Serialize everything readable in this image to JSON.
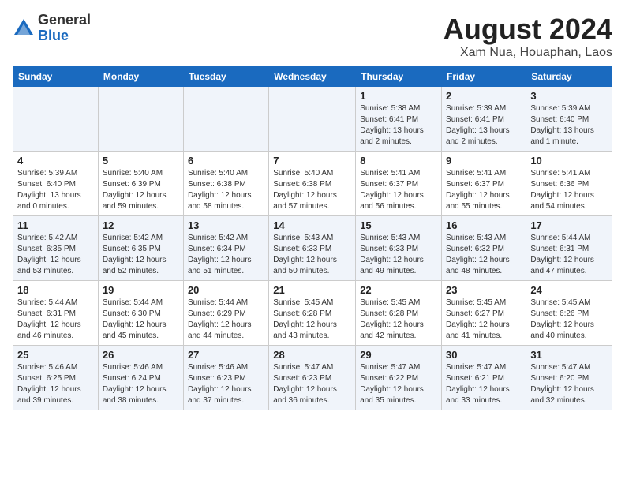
{
  "header": {
    "logo": {
      "general": "General",
      "blue": "Blue"
    },
    "month_year": "August 2024",
    "location": "Xam Nua, Houaphan, Laos"
  },
  "days_of_week": [
    "Sunday",
    "Monday",
    "Tuesday",
    "Wednesday",
    "Thursday",
    "Friday",
    "Saturday"
  ],
  "weeks": [
    [
      {
        "num": "",
        "info": ""
      },
      {
        "num": "",
        "info": ""
      },
      {
        "num": "",
        "info": ""
      },
      {
        "num": "",
        "info": ""
      },
      {
        "num": "1",
        "info": "Sunrise: 5:38 AM\nSunset: 6:41 PM\nDaylight: 13 hours\nand 2 minutes."
      },
      {
        "num": "2",
        "info": "Sunrise: 5:39 AM\nSunset: 6:41 PM\nDaylight: 13 hours\nand 2 minutes."
      },
      {
        "num": "3",
        "info": "Sunrise: 5:39 AM\nSunset: 6:40 PM\nDaylight: 13 hours\nand 1 minute."
      }
    ],
    [
      {
        "num": "4",
        "info": "Sunrise: 5:39 AM\nSunset: 6:40 PM\nDaylight: 13 hours\nand 0 minutes."
      },
      {
        "num": "5",
        "info": "Sunrise: 5:40 AM\nSunset: 6:39 PM\nDaylight: 12 hours\nand 59 minutes."
      },
      {
        "num": "6",
        "info": "Sunrise: 5:40 AM\nSunset: 6:38 PM\nDaylight: 12 hours\nand 58 minutes."
      },
      {
        "num": "7",
        "info": "Sunrise: 5:40 AM\nSunset: 6:38 PM\nDaylight: 12 hours\nand 57 minutes."
      },
      {
        "num": "8",
        "info": "Sunrise: 5:41 AM\nSunset: 6:37 PM\nDaylight: 12 hours\nand 56 minutes."
      },
      {
        "num": "9",
        "info": "Sunrise: 5:41 AM\nSunset: 6:37 PM\nDaylight: 12 hours\nand 55 minutes."
      },
      {
        "num": "10",
        "info": "Sunrise: 5:41 AM\nSunset: 6:36 PM\nDaylight: 12 hours\nand 54 minutes."
      }
    ],
    [
      {
        "num": "11",
        "info": "Sunrise: 5:42 AM\nSunset: 6:35 PM\nDaylight: 12 hours\nand 53 minutes."
      },
      {
        "num": "12",
        "info": "Sunrise: 5:42 AM\nSunset: 6:35 PM\nDaylight: 12 hours\nand 52 minutes."
      },
      {
        "num": "13",
        "info": "Sunrise: 5:42 AM\nSunset: 6:34 PM\nDaylight: 12 hours\nand 51 minutes."
      },
      {
        "num": "14",
        "info": "Sunrise: 5:43 AM\nSunset: 6:33 PM\nDaylight: 12 hours\nand 50 minutes."
      },
      {
        "num": "15",
        "info": "Sunrise: 5:43 AM\nSunset: 6:33 PM\nDaylight: 12 hours\nand 49 minutes."
      },
      {
        "num": "16",
        "info": "Sunrise: 5:43 AM\nSunset: 6:32 PM\nDaylight: 12 hours\nand 48 minutes."
      },
      {
        "num": "17",
        "info": "Sunrise: 5:44 AM\nSunset: 6:31 PM\nDaylight: 12 hours\nand 47 minutes."
      }
    ],
    [
      {
        "num": "18",
        "info": "Sunrise: 5:44 AM\nSunset: 6:31 PM\nDaylight: 12 hours\nand 46 minutes."
      },
      {
        "num": "19",
        "info": "Sunrise: 5:44 AM\nSunset: 6:30 PM\nDaylight: 12 hours\nand 45 minutes."
      },
      {
        "num": "20",
        "info": "Sunrise: 5:44 AM\nSunset: 6:29 PM\nDaylight: 12 hours\nand 44 minutes."
      },
      {
        "num": "21",
        "info": "Sunrise: 5:45 AM\nSunset: 6:28 PM\nDaylight: 12 hours\nand 43 minutes."
      },
      {
        "num": "22",
        "info": "Sunrise: 5:45 AM\nSunset: 6:28 PM\nDaylight: 12 hours\nand 42 minutes."
      },
      {
        "num": "23",
        "info": "Sunrise: 5:45 AM\nSunset: 6:27 PM\nDaylight: 12 hours\nand 41 minutes."
      },
      {
        "num": "24",
        "info": "Sunrise: 5:45 AM\nSunset: 6:26 PM\nDaylight: 12 hours\nand 40 minutes."
      }
    ],
    [
      {
        "num": "25",
        "info": "Sunrise: 5:46 AM\nSunset: 6:25 PM\nDaylight: 12 hours\nand 39 minutes."
      },
      {
        "num": "26",
        "info": "Sunrise: 5:46 AM\nSunset: 6:24 PM\nDaylight: 12 hours\nand 38 minutes."
      },
      {
        "num": "27",
        "info": "Sunrise: 5:46 AM\nSunset: 6:23 PM\nDaylight: 12 hours\nand 37 minutes."
      },
      {
        "num": "28",
        "info": "Sunrise: 5:47 AM\nSunset: 6:23 PM\nDaylight: 12 hours\nand 36 minutes."
      },
      {
        "num": "29",
        "info": "Sunrise: 5:47 AM\nSunset: 6:22 PM\nDaylight: 12 hours\nand 35 minutes."
      },
      {
        "num": "30",
        "info": "Sunrise: 5:47 AM\nSunset: 6:21 PM\nDaylight: 12 hours\nand 33 minutes."
      },
      {
        "num": "31",
        "info": "Sunrise: 5:47 AM\nSunset: 6:20 PM\nDaylight: 12 hours\nand 32 minutes."
      }
    ]
  ]
}
